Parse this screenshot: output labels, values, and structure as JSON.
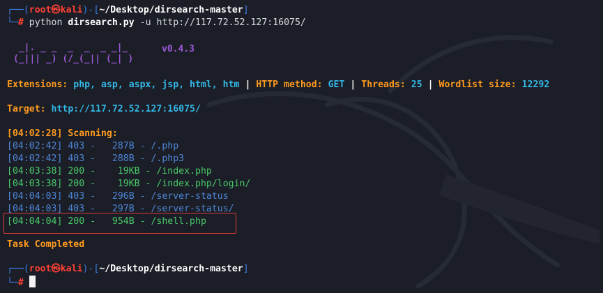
{
  "prompt1": {
    "open": "┌──(",
    "user": "root",
    "at": "㉿",
    "host": "kali",
    "mid": ")-[",
    "path": "~/Desktop/dirsearch-master",
    "close": "]",
    "corner": "└─",
    "hash": "#",
    "cmd_prog": "python",
    "cmd_script": "dirsearch.py",
    "cmd_flag": "-u",
    "cmd_url": "http://117.72.52.127:16075/"
  },
  "logo": {
    "line1": " _|. _ _  _  _  _ _|_",
    "line2": "(_||| _) (/_(_|| (_| )",
    "version": "v0.4.3"
  },
  "config": {
    "ext_label": "Extensions:",
    "ext_value": "php, asp, aspx, jsp, html, htm",
    "sep": "|",
    "method_label": "HTTP method:",
    "method_value": "GET",
    "threads_label": "Threads:",
    "threads_value": "25",
    "wordlist_label": "Wordlist size:",
    "wordlist_value": "12292"
  },
  "target": {
    "label": "Target:",
    "url": "http://117.72.52.127:16075/"
  },
  "scan": {
    "start": "[04:02:28] Scanning:",
    "results": [
      {
        "time": "[04:02:42]",
        "code": "403",
        "size": "  287B",
        "path": "/.php"
      },
      {
        "time": "[04:02:42]",
        "code": "403",
        "size": "  288B",
        "path": "/.php3"
      },
      {
        "time": "[04:03:38]",
        "code": "200",
        "size": "   19KB",
        "path": "/index.php"
      },
      {
        "time": "[04:03:38]",
        "code": "200",
        "size": "   19KB",
        "path": "/index.php/login/"
      },
      {
        "time": "[04:04:03]",
        "code": "403",
        "size": "  296B",
        "path": "/server-status"
      },
      {
        "time": "[04:04:03]",
        "code": "403",
        "size": "  297B",
        "path": "/server-status/"
      },
      {
        "time": "[04:04:04]",
        "code": "200",
        "size": "  954B",
        "path": "/shell.php"
      }
    ],
    "done": "Task Completed"
  },
  "prompt2": {
    "open": "┌──(",
    "user": "root",
    "at": "㉿",
    "host": "kali",
    "mid": ")-[",
    "path": "~/Desktop/dirsearch-master",
    "close": "]",
    "corner": "└─",
    "hash": "#"
  },
  "colors": {
    "background": "#1b1e26",
    "accent_orange": "#ff9a1f",
    "accent_cyan": "#34b6e6",
    "prompt_red": "#ff4136",
    "frame_blue": "#3b7de8",
    "status_200": "#49c96b",
    "status_403": "#4e86d8",
    "highlight_border": "#e23b3b"
  },
  "icons": {
    "cursor": "block-cursor-icon",
    "watermark": "kali-dragon-icon"
  }
}
